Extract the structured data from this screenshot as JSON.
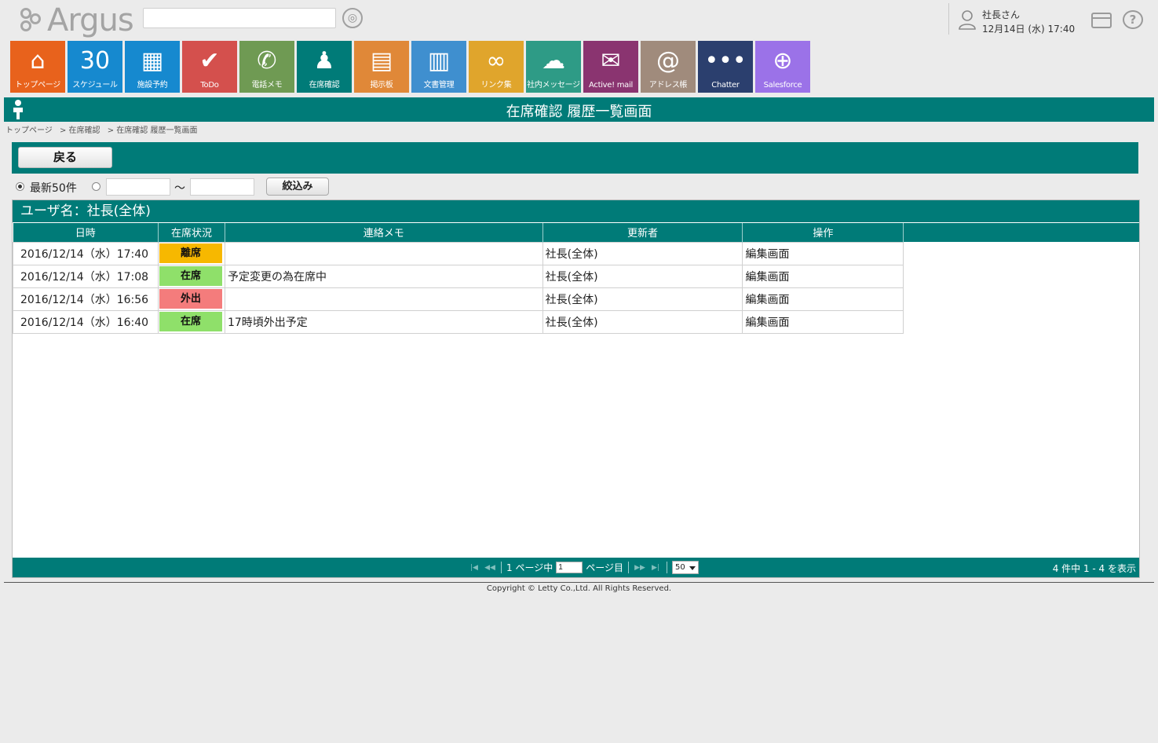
{
  "header": {
    "logo_text": "Argus",
    "search_placeholder": "",
    "user_name": "社長さん",
    "user_datetime": "12月14日 (水) 17:40"
  },
  "tiles": [
    {
      "label": "トップページ",
      "icon": "home-icon",
      "color": "#e8621c",
      "glyph": "⌂"
    },
    {
      "label": "スケジュール",
      "icon": "calendar-icon",
      "color": "#1689cf",
      "glyph": "30"
    },
    {
      "label": "施設予約",
      "icon": "facility-icon",
      "color": "#1689cf",
      "glyph": "▦"
    },
    {
      "label": "ToDo",
      "icon": "todo-icon",
      "color": "#d4504d",
      "glyph": "✔"
    },
    {
      "label": "電話メモ",
      "icon": "phone-icon",
      "color": "#6f9a53",
      "glyph": "✆"
    },
    {
      "label": "在席確認",
      "icon": "presence-icon",
      "color": "#007b78",
      "glyph": "♟"
    },
    {
      "label": "掲示板",
      "icon": "board-icon",
      "color": "#e08838",
      "glyph": "▤"
    },
    {
      "label": "文書管理",
      "icon": "document-icon",
      "color": "#3f8fcf",
      "glyph": "▥"
    },
    {
      "label": "リンク集",
      "icon": "link-icon",
      "color": "#e0a52c",
      "glyph": "∞"
    },
    {
      "label": "社内メッセージ",
      "icon": "message-icon",
      "color": "#2e9b86",
      "glyph": "☁"
    },
    {
      "label": "Active! mail",
      "icon": "mail-icon",
      "color": "#8a3470",
      "glyph": "✉"
    },
    {
      "label": "アドレス帳",
      "icon": "addressbook-icon",
      "color": "#a08b7c",
      "glyph": "@"
    },
    {
      "label": "Chatter",
      "icon": "chatter-icon",
      "color": "#2b3f6e",
      "glyph": "•••"
    },
    {
      "label": "Salesforce",
      "icon": "globe-icon",
      "color": "#9b72e8",
      "glyph": "⊕"
    }
  ],
  "page": {
    "title": "在席確認 履歴一覧画面",
    "breadcrumb": [
      "トップページ",
      "> 在席確認",
      "> 在席確認 履歴一覧画面"
    ]
  },
  "toolbar": {
    "back_label": "戻る"
  },
  "filter": {
    "latest_label": "最新50件",
    "latest_selected": true,
    "from_value": "",
    "to_value": "",
    "tilde": "～",
    "filter_label": "絞込み"
  },
  "panel": {
    "user_heading": "ユーザ名：社長(全体)",
    "columns": [
      "日時",
      "在席状況",
      "連絡メモ",
      "更新者",
      "操作"
    ],
    "rows": [
      {
        "datetime": "2016/12/14（水）17:40",
        "status": "離席",
        "status_color": "#f7b800",
        "memo": "",
        "updater": "社長(全体)",
        "action": "編集画面"
      },
      {
        "datetime": "2016/12/14（水）17:08",
        "status": "在席",
        "status_color": "#8fe06a",
        "memo": "予定変更の為在席中",
        "updater": "社長(全体)",
        "action": "編集画面"
      },
      {
        "datetime": "2016/12/14（水）16:56",
        "status": "外出",
        "status_color": "#f47c7c",
        "memo": "",
        "updater": "社長(全体)",
        "action": "編集画面"
      },
      {
        "datetime": "2016/12/14（水）16:40",
        "status": "在席",
        "status_color": "#8fe06a",
        "memo": "17時頃外出予定",
        "updater": "社長(全体)",
        "action": "編集画面"
      }
    ]
  },
  "pager": {
    "total_pages_text": "1 ページ中",
    "page_value": "1",
    "page_suffix": "ページ目",
    "page_size": "50",
    "summary": "4 件中 1 - 4 を表示"
  },
  "footer": {
    "copyright": "Copyright © Letty Co.,Ltd. All Rights Reserved."
  }
}
